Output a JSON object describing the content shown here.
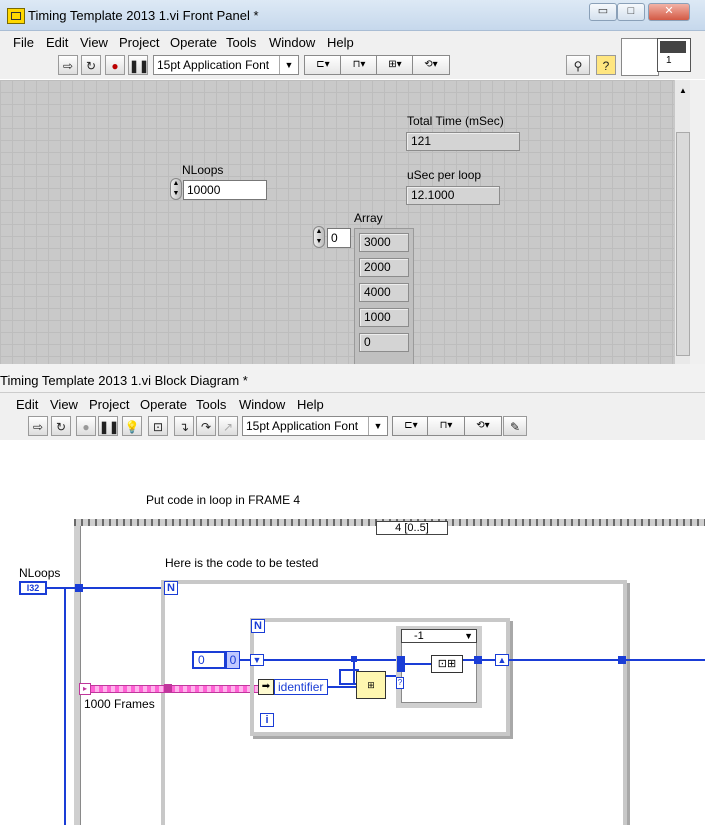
{
  "front_panel": {
    "title": "Timing Template 2013 1.vi Front Panel *",
    "menu": [
      "File",
      "Edit",
      "View",
      "Project",
      "Operate",
      "Tools",
      "Window",
      "Help"
    ],
    "font": "15pt Application Font",
    "total_time": {
      "label": "Total Time (mSec)",
      "value": "121"
    },
    "usec_per_loop": {
      "label": "uSec per loop",
      "value": "12.1000"
    },
    "nloops": {
      "label": "NLoops",
      "value": "10000"
    },
    "array": {
      "label": "Array",
      "index": "0",
      "values": [
        "3000",
        "2000",
        "4000",
        "1000",
        "0"
      ]
    },
    "window_buttons": {
      "minimize": "▭",
      "maximize": "□",
      "close": "✕"
    },
    "connector_number": "1"
  },
  "block_diagram": {
    "title": "Timing Template 2013 1.vi Block Diagram *",
    "menu": [
      "Edit",
      "View",
      "Project",
      "Operate",
      "Tools",
      "Window",
      "Help"
    ],
    "font": "15pt Application Font",
    "comment_top": "Put code in loop in FRAME 4",
    "comment_code": "Here is the code to be tested",
    "sequence_selector": "4 [0..5]",
    "nloops_label": "NLoops",
    "nloops_terminal": "I32",
    "for_loop_n": "N",
    "inner_loop_n": "N",
    "iteration_i": "i",
    "init_constant": "0",
    "init_indicator": "0",
    "identifier_label": "identifier",
    "frames_label": "1000 Frames",
    "case_selector": "-1"
  }
}
